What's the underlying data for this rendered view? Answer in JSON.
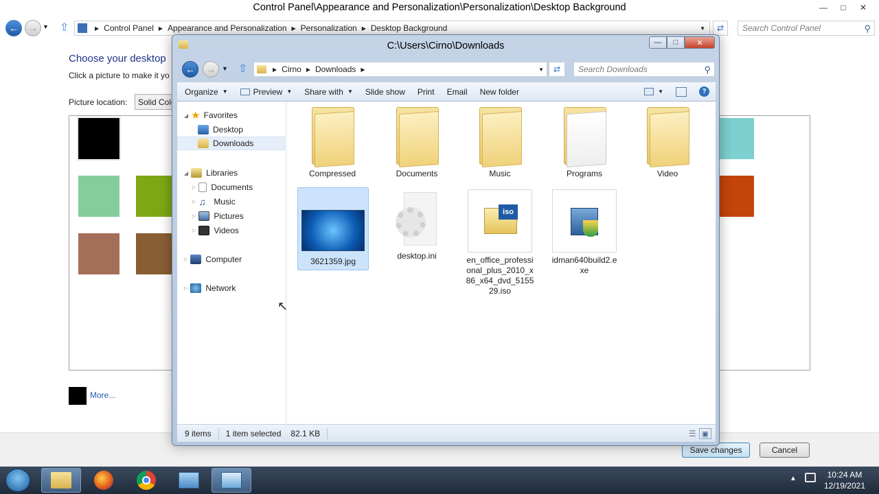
{
  "control_panel": {
    "title": "Control Panel\\Appearance and Personalization\\Personalization\\Desktop Background",
    "breadcrumb": [
      "Control Panel",
      "Appearance and Personalization",
      "Personalization",
      "Desktop Background"
    ],
    "search_placeholder": "Search Control Panel",
    "heading": "Choose your desktop",
    "subheading": "Click a picture to make it yo",
    "picture_location_label": "Picture location:",
    "picture_location_value": "Solid Colors",
    "more_link": "More...",
    "save_button": "Save changes",
    "cancel_button": "Cancel",
    "swatch_colors": [
      "#000000",
      "#ffffff",
      "#86cd9c",
      "#7da814",
      "#a46f58",
      "#8a5e35",
      "#7ecfcf",
      "#c4450c"
    ]
  },
  "explorer": {
    "title": "C:\\Users\\Cirno\\Downloads",
    "breadcrumb": [
      "Cirno",
      "Downloads"
    ],
    "search_placeholder": "Search Downloads",
    "toolbar": {
      "organize": "Organize",
      "preview": "Preview",
      "share_with": "Share with",
      "slide_show": "Slide show",
      "print": "Print",
      "email": "Email",
      "new_folder": "New folder"
    },
    "nav": {
      "favorites": "Favorites",
      "desktop": "Desktop",
      "downloads": "Downloads",
      "libraries": "Libraries",
      "documents": "Documents",
      "music": "Music",
      "pictures": "Pictures",
      "videos": "Videos",
      "computer": "Computer",
      "network": "Network"
    },
    "items": [
      {
        "name": "Compressed"
      },
      {
        "name": "Documents"
      },
      {
        "name": "Music"
      },
      {
        "name": "Programs"
      },
      {
        "name": "Video"
      },
      {
        "name": "3621359.jpg"
      },
      {
        "name": "desktop.ini"
      },
      {
        "name": "en_office_professional_plus_2010_x86_x64_dvd_515529.iso"
      },
      {
        "name": "idman640build2.exe"
      }
    ],
    "status": {
      "count": "9 items",
      "selected": "1 item selected",
      "size": "82.1 KB"
    }
  },
  "taskbar": {
    "time": "10:24 AM",
    "date": "12/19/2021"
  }
}
